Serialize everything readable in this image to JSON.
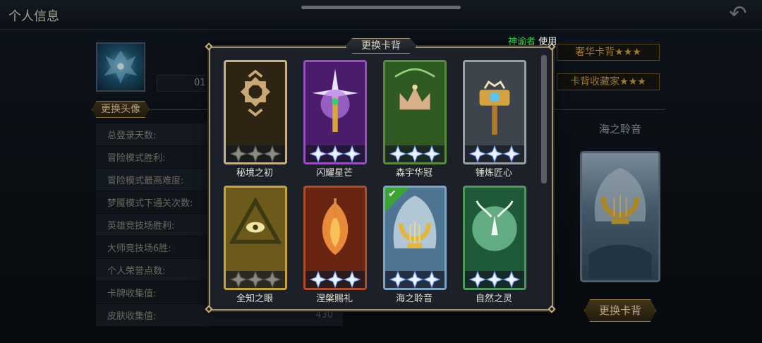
{
  "header": {
    "title": "个人信息"
  },
  "profile": {
    "id_text": "01",
    "change_avatar_label": "更换头像"
  },
  "stats": [
    {
      "label": "总登录天数:",
      "value": ""
    },
    {
      "label": "冒险模式胜利:",
      "value": ""
    },
    {
      "label": "冒险模式最高难度:",
      "value": ""
    },
    {
      "label": "梦魇模式下通关次数:",
      "value": ""
    },
    {
      "label": "英雄竞技场胜利:",
      "value": ""
    },
    {
      "label": "大师竞技场6胜:",
      "value": ""
    },
    {
      "label": "个人荣誉点数:",
      "value": ""
    },
    {
      "label": "卡牌收集值:",
      "value": ""
    },
    {
      "label": "皮肤收集值:",
      "value": "430"
    }
  ],
  "badges": [
    "奢华卡背★★★",
    "卡背收藏家★★★"
  ],
  "right_panel": {
    "current_back_name": "海之聆音",
    "change_back_label": "更换卡背"
  },
  "modal": {
    "title": "更换卡背",
    "user_name": "神谕者",
    "use_label": "使用",
    "cards": [
      {
        "name": "秘境之初",
        "theme": "rune",
        "frame_color": "#c7b08a",
        "bg_color": "#2e2414",
        "stars": 0,
        "selected": false
      },
      {
        "name": "闪耀星芒",
        "theme": "star",
        "frame_color": "#9a4fc0",
        "bg_color": "#4b1c6b",
        "stars": 3,
        "selected": false
      },
      {
        "name": "森宇华冠",
        "theme": "crown",
        "frame_color": "#5c8a3c",
        "bg_color": "#2f5a22",
        "stars": 3,
        "selected": false
      },
      {
        "name": "锤炼匠心",
        "theme": "hammer",
        "frame_color": "#9aa0a8",
        "bg_color": "#3e444c",
        "stars": 3,
        "selected": false
      },
      {
        "name": "全知之眼",
        "theme": "eye",
        "frame_color": "#c9a23a",
        "bg_color": "#6b5a1a",
        "stars": 0,
        "selected": false
      },
      {
        "name": "涅槃赐礼",
        "theme": "phoenix",
        "frame_color": "#b04c2a",
        "bg_color": "#6a2412",
        "stars": 3,
        "selected": false
      },
      {
        "name": "海之聆音",
        "theme": "lyre",
        "frame_color": "#7fa3c2",
        "bg_color": "#4d7593",
        "stars": 3,
        "selected": true
      },
      {
        "name": "自然之灵",
        "theme": "deer",
        "frame_color": "#4d9a5c",
        "bg_color": "#1f5a38",
        "stars": 3,
        "selected": false
      }
    ]
  }
}
